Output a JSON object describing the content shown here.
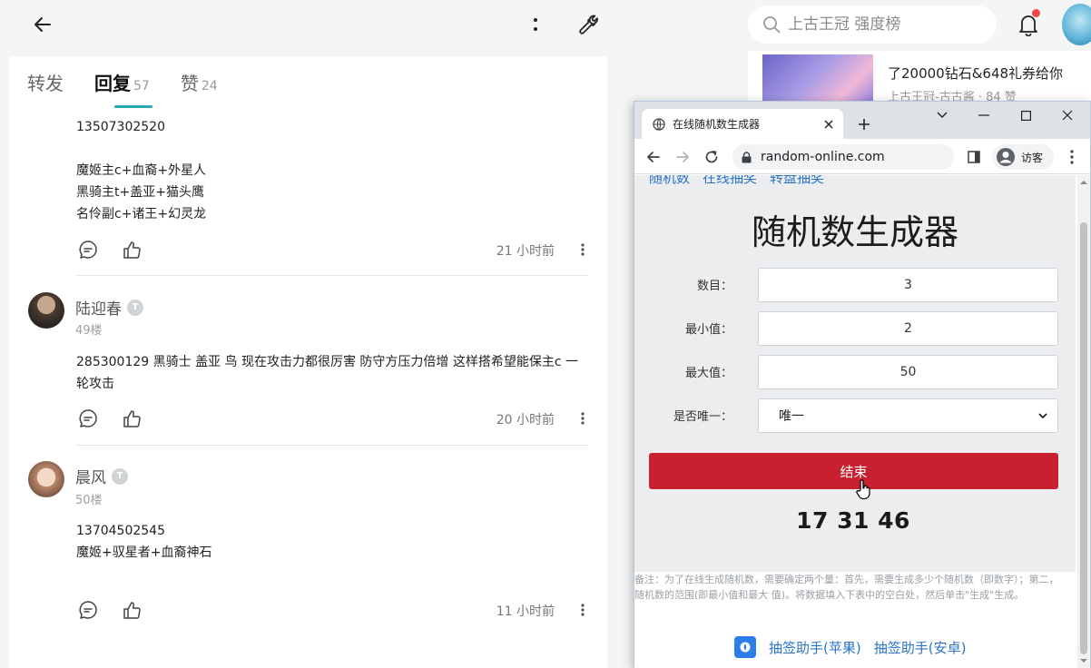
{
  "app": {
    "search": {
      "placeholder": "上古王冠 强度榜"
    },
    "tabs": [
      {
        "label": "转发",
        "count": ""
      },
      {
        "label": "回复",
        "count": "57"
      },
      {
        "label": "赞",
        "count": "24"
      }
    ],
    "comments": [
      {
        "name": "",
        "floor": "",
        "text": "13507302520\n\n魔姬主c+血裔+外星人\n黑骑主t+盖亚+猫头鹰\n名伶副c+诸王+幻灵龙",
        "time": "21 小时前"
      },
      {
        "name": "陆迎春",
        "floor": "49楼",
        "text": "285300129 黑骑士 盖亚 鸟  现在攻击力都很厉害 防守方压力倍增 这样搭希望能保主c 一轮攻击",
        "time": "20 小时前"
      },
      {
        "name": "晨风",
        "floor": "50楼",
        "text": "13704502545\n魔姬+驭星者+血裔神石",
        "time": "11 小时前"
      }
    ],
    "feed": {
      "title": "了20000钻石&648礼券给你",
      "meta": "上古王冠-古古酱 · 84 赞"
    }
  },
  "browser": {
    "tab_title": "在线随机数生成器",
    "url": "random-online.com",
    "profile_label": "访客",
    "page": {
      "top_links": [
        "随机数",
        "在线抽奖",
        "转盘抽奖"
      ],
      "title": "随机数生成器",
      "fields": [
        {
          "label": "数目：",
          "value": "3"
        },
        {
          "label": "最小值：",
          "value": "2"
        },
        {
          "label": "最大值：",
          "value": "50"
        }
      ],
      "unique": {
        "label": "是否唯一：",
        "selected": "唯一"
      },
      "button_label": "结束",
      "result": "17 31 46",
      "note": "备注：为了在线生成随机数，需要确定两个量：首先，需要生成多少个随机数（即数字）；第二，随机数的范围(即最小值和最大 值)。将数据填入下表中的空白处，然后单击\"生成\"生成。",
      "helper_links": [
        "抽签助手(苹果)",
        "抽签助手(安卓)"
      ]
    }
  },
  "colors": {
    "accent_teal": "#27a8b5",
    "button_red": "#c8202f",
    "link_blue": "#2a74c8"
  }
}
